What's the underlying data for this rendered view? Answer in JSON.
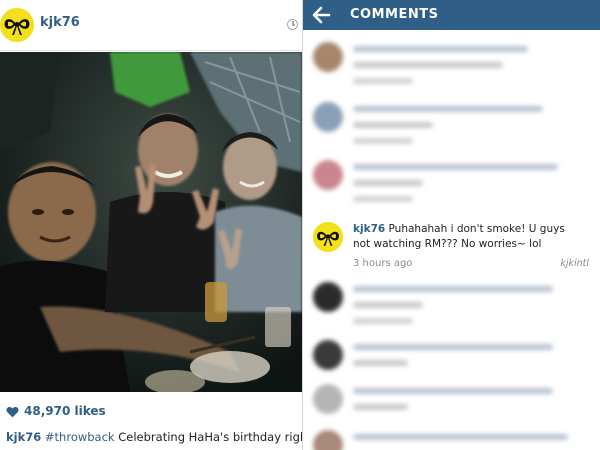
{
  "post": {
    "username": "kjk76",
    "likes": "48,970 likes",
    "caption": {
      "username": "kjk76",
      "hashtag": "#throwback",
      "text": " Celebrating HaHa's birthday right"
    },
    "icons": [
      "bow-avatar-icon",
      "clock-icon",
      "heart-icon"
    ]
  },
  "comments": {
    "title": "COMMENTS",
    "back_icon": "arrow-left-icon",
    "featured": {
      "username": "kjk76",
      "text": "Puhahahah i don't smoke! U guys not watching RM??? No worries~ lol",
      "time": "3 hours ago",
      "watermark": "kjkintl"
    }
  },
  "colors": {
    "accent": "#2f5e86",
    "avatar_yellow": "#f4df1c",
    "text_muted": "#8a8a8a"
  }
}
